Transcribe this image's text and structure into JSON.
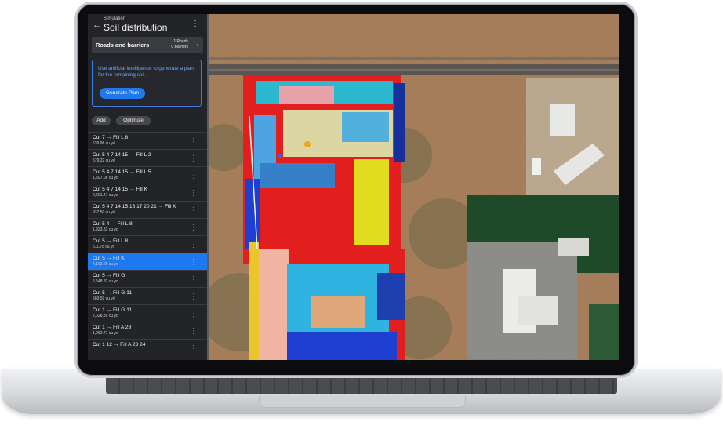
{
  "sidebar": {
    "subtitle": "Simulation",
    "title": "Soil distribution",
    "roads_card": {
      "title": "Roads and barriers",
      "roads": "1 Roads",
      "barriers": "0 Barriers"
    },
    "ai_card": {
      "text": "Use artificial intelligence to generate a plan for the remaining soil.",
      "button": "Generate Plan"
    },
    "add_label": "Add",
    "optimize_label": "Optimize",
    "items": [
      {
        "title": "Cut 7 → Fill L 8",
        "volume": "639.96 cu yd",
        "selected": false
      },
      {
        "title": "Cut 5 4 7 14 15 → Fill L 2",
        "volume": "579.22 cu yd",
        "selected": false
      },
      {
        "title": "Cut 5 4 7 14 15 → Fill L 5",
        "volume": "1,597.08 cu yd",
        "selected": false
      },
      {
        "title": "Cut 5 4 7 14 15 → Fill K",
        "volume": "2,691.47 cu yd",
        "selected": false
      },
      {
        "title": "Cut 5 4 7 14 15 16 17 20 21 → Fill K",
        "volume": "937.50 cu yd",
        "selected": false
      },
      {
        "title": "Cut 5 4 → Fill L 8",
        "volume": "1,923.33 cu yd",
        "selected": false
      },
      {
        "title": "Cut 5 → Fill L 8",
        "volume": "511.78 cu yd",
        "selected": false
      },
      {
        "title": "Cut 5 → Fill K",
        "volume": "4,162.28 cu yd",
        "selected": true
      },
      {
        "title": "Cut 5 → Fill G",
        "volume": "2,548.82 cu yd",
        "selected": false
      },
      {
        "title": "Cut 5 → Fill G 11",
        "volume": "560.59 cu yd",
        "selected": false
      },
      {
        "title": "Cut 1 → Fill G 11",
        "volume": "2,028.39 cu yd",
        "selected": false
      },
      {
        "title": "Cut 1 → Fill A 23",
        "volume": "1,262.77 cu yd",
        "selected": false
      },
      {
        "title": "Cut 1 12 → Fill A 23 24",
        "volume": "",
        "selected": false
      }
    ]
  },
  "colors": {
    "accent": "#1e78f0",
    "ai_text": "#6ba6ff",
    "panel": "#232427"
  },
  "icons": {
    "back": "arrow-left-icon",
    "more": "kebab-icon",
    "go": "arrow-right-icon"
  }
}
